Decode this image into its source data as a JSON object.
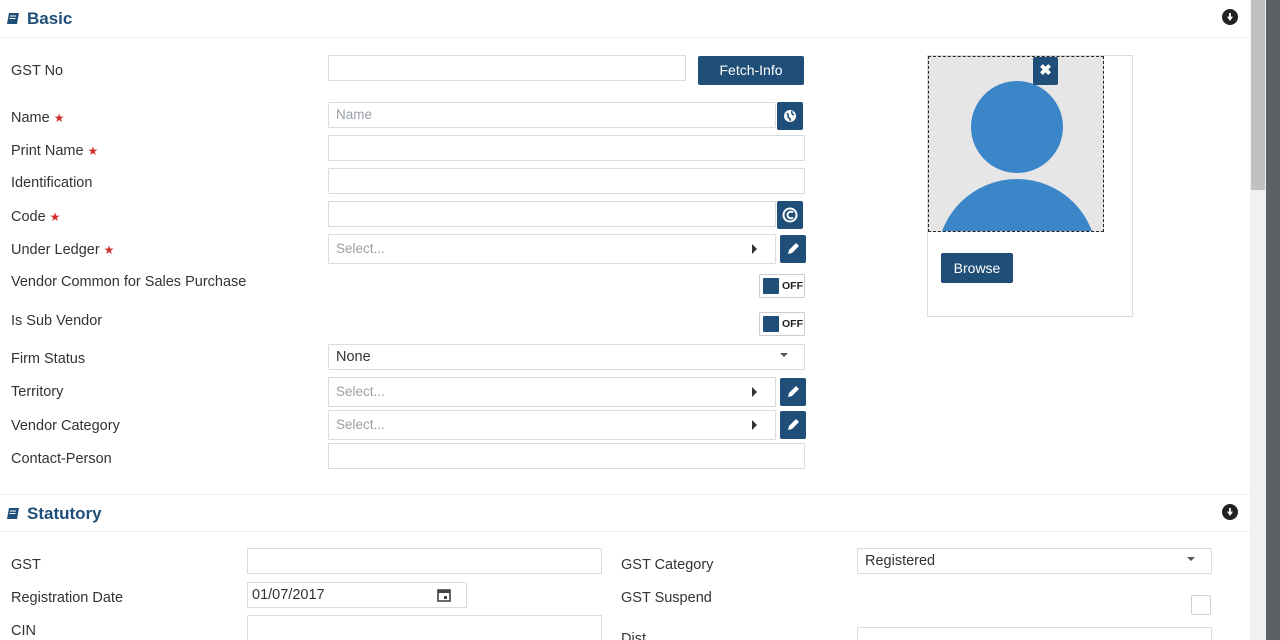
{
  "basic": {
    "title": "Basic",
    "gst_no": {
      "label": "GST No",
      "value": ""
    },
    "fetch_info_label": "Fetch-Info",
    "name": {
      "label": "Name",
      "placeholder": "Name",
      "required": "★"
    },
    "print_name": {
      "label": "Print Name",
      "value": "",
      "required": "★"
    },
    "identification": {
      "label": "Identification",
      "value": ""
    },
    "code": {
      "label": "Code",
      "value": "",
      "required": "★"
    },
    "under_ledger": {
      "label": "Under Ledger",
      "placeholder": "Select...",
      "required": "★"
    },
    "vendor_common": {
      "label": "Vendor Common for Sales Purchase",
      "toggle": "OFF"
    },
    "is_sub_vendor": {
      "label": "Is Sub Vendor",
      "toggle": "OFF"
    },
    "firm_status": {
      "label": "Firm Status",
      "value": "None"
    },
    "territory": {
      "label": "Territory",
      "placeholder": "Select..."
    },
    "vendor_category": {
      "label": "Vendor Category",
      "placeholder": "Select..."
    },
    "contact_person": {
      "label": "Contact-Person",
      "value": ""
    },
    "photo": {
      "close": "✖",
      "browse_label": "Browse"
    }
  },
  "statutory": {
    "title": "Statutory",
    "gst": {
      "label": "GST",
      "value": ""
    },
    "registration_date": {
      "label": "Registration Date",
      "value": "01/07/2017"
    },
    "cin": {
      "label": "CIN",
      "value": ""
    },
    "gst_category": {
      "label": "GST Category",
      "value": "Registered"
    },
    "gst_suspend": {
      "label": "GST Suspend"
    },
    "dist": {
      "label": "Dist"
    }
  },
  "colors": {
    "primary": "#1f4e79",
    "required": "#d32f2f",
    "avatar": "#3a86c8"
  },
  "icons": [
    "book-icon",
    "collapse-icon",
    "globe-icon",
    "code-gen-icon",
    "edit-icon",
    "calendar-icon",
    "close-icon"
  ]
}
